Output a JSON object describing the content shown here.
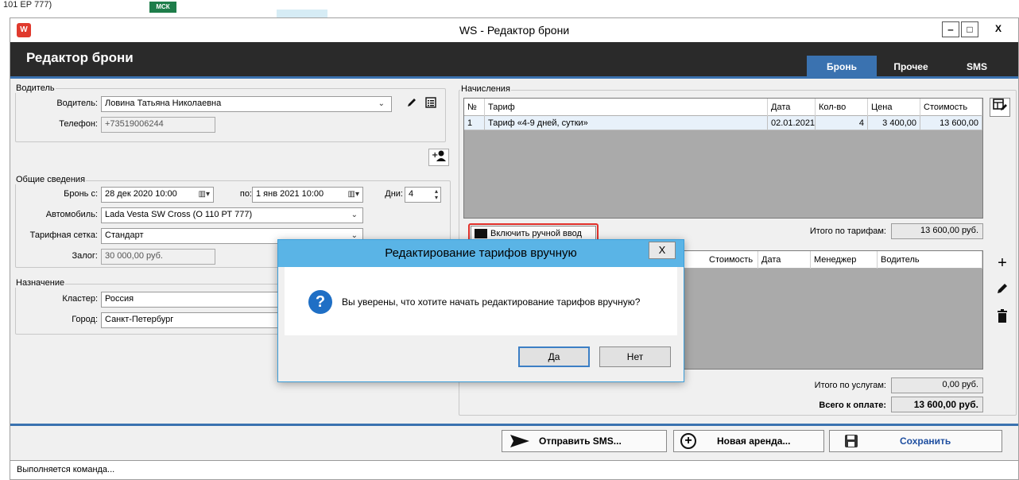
{
  "background": {
    "text": "101 ЕР 777)",
    "badge": "МСК"
  },
  "window": {
    "title": "WS - Редактор брони",
    "icon": "W",
    "controls": {
      "minimize": "‒",
      "maximize": "□",
      "close": "X"
    }
  },
  "header": {
    "title": "Редактор брони",
    "tabs": [
      "Бронь",
      "Прочее",
      "SMS"
    ]
  },
  "driver_group": {
    "legend": "Водитель",
    "driver_label": "Водитель:",
    "driver_value": "Ловина Татьяна Николаевна",
    "phone_label": "Телефон:",
    "phone_value": "+73519006244"
  },
  "general_group": {
    "legend": "Общие сведения",
    "from_label": "Бронь с:",
    "from_value": "28 дек 2020  10:00",
    "to_label": "по:",
    "to_value": "1 янв  2021  10:00",
    "days_label": "Дни:",
    "days_value": "4",
    "car_label": "Автомобиль:",
    "car_value": "Lada Vesta SW Cross (О 110 РТ 777)",
    "tariff_label": "Тарифная сетка:",
    "tariff_value": "Стандарт",
    "deposit_label": "Залог:",
    "deposit_value": "30 000,00 руб."
  },
  "purpose_group": {
    "legend": "Назначение",
    "cluster_label": "Кластер:",
    "cluster_value": "Россия",
    "city_label": "Город:",
    "city_value": "Санкт-Петербург"
  },
  "charges": {
    "legend": "Начисления",
    "columns": [
      "№",
      "Тариф",
      "Дата",
      "Кол-во",
      "Цена",
      "Стоимость"
    ],
    "rows": [
      [
        "1",
        "Тариф «4-9 дней, сутки»",
        "02.01.2021",
        "4",
        "3 400,00",
        "13 600,00"
      ]
    ],
    "manual_button": "Включить ручной ввод",
    "total_label": "Итого по тарифам:",
    "total_value": "13 600,00 руб."
  },
  "services": {
    "columns": [
      "Стоимость",
      "Дата",
      "Менеджер",
      "Водитель"
    ],
    "total_label": "Итого по услугам:",
    "total_value": "0,00 руб.",
    "grand_label": "Всего к оплате:",
    "grand_value": "13 600,00 руб."
  },
  "footer": {
    "send_sms": "Отправить SMS...",
    "new_rent": "Новая аренда...",
    "save": "Сохранить"
  },
  "status": "Выполняется команда...",
  "dialog": {
    "title": "Редактирование тарифов вручную",
    "close": "X",
    "message": "Вы уверены, что хотите начать редактирование тарифов вручную?",
    "yes": "Да",
    "no": "Нет"
  },
  "colors": {
    "accent": "#3a72b0",
    "header_bg": "#2a2a2a",
    "dialog_title": "#5ab4e6",
    "highlight": "#e0302a"
  }
}
